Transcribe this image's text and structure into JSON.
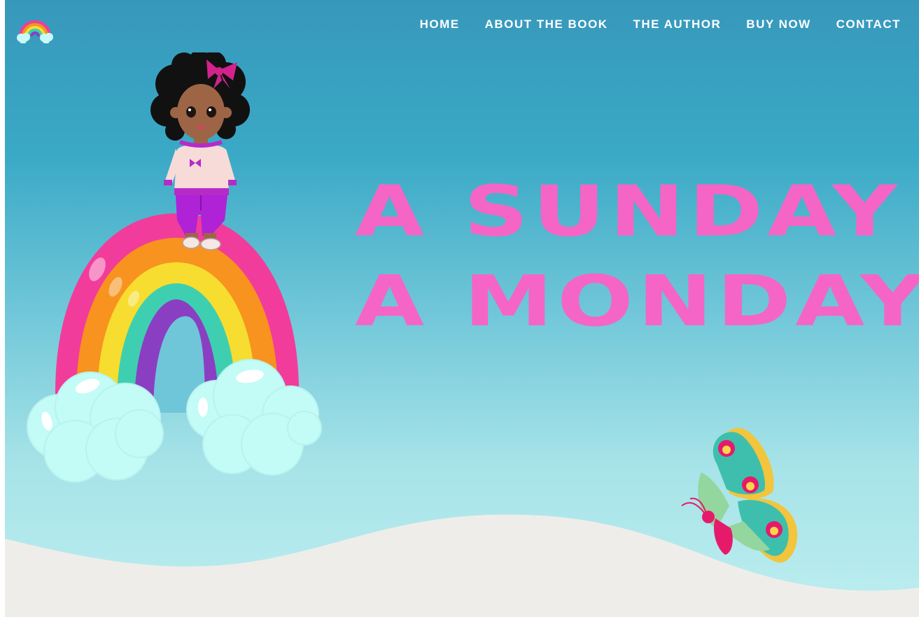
{
  "site": {
    "logo_icon": "rainbow-cloud-icon"
  },
  "nav": {
    "items": [
      "HOME",
      "ABOUT THE BOOK",
      "THE AUTHOR",
      "BUY NOW",
      "CONTACT"
    ]
  },
  "hero": {
    "title_line1": "A SUNDAY ON",
    "title_line2": "A MONDAY",
    "illustrations": [
      "girl-on-rainbow-illustration",
      "rainbow-illustration",
      "butterfly-illustration"
    ]
  },
  "colors": {
    "sky_top": "#3798bb",
    "sky_bottom": "#bdeef0",
    "title_pink": "#f565c6",
    "ground": "#efedea",
    "nav_text": "#ffffff"
  }
}
